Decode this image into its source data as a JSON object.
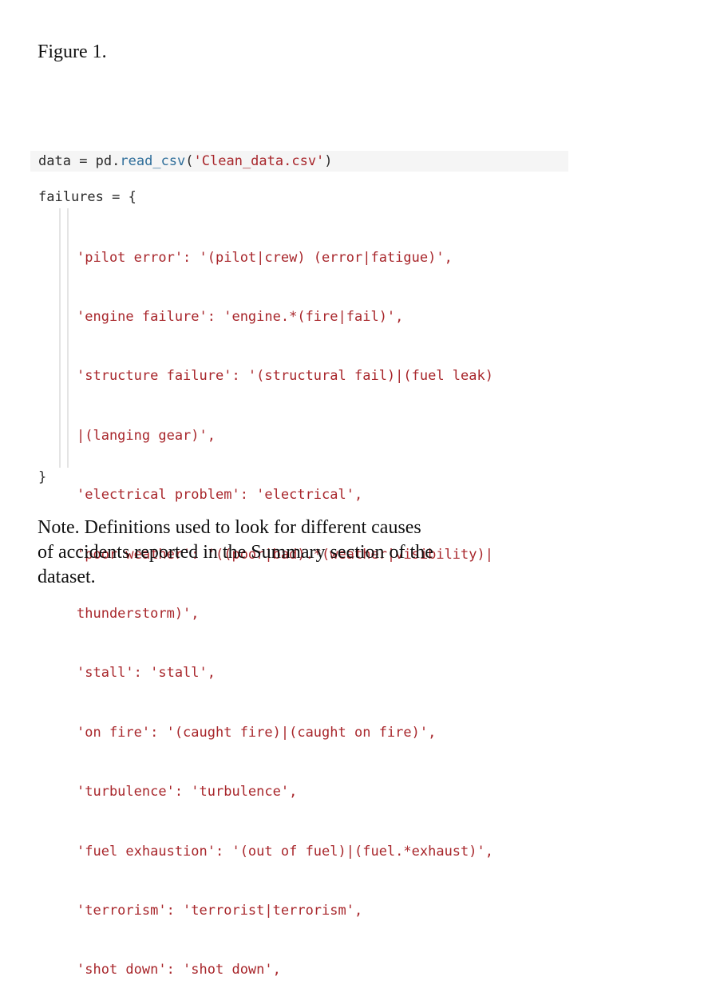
{
  "figure_label": "Figure 1.",
  "code": {
    "read_var": "data",
    "read_assign": " = ",
    "read_module": "pd.",
    "read_func": "read_csv",
    "read_open": "(",
    "read_arg": "'Clean_data.csv'",
    "read_close": ")",
    "failures_open": "failures = {",
    "entries": [
      "'pilot error': '(pilot|crew) (error|fatigue)',",
      "'engine failure': 'engine.*(fire|fail)',",
      "'structure failure': '(structural fail)|(fuel leak)",
      "|(langing gear)',",
      "'electrical problem': 'electrical',",
      "'poor weather': '((poor|bad).*(weather|visibility)|",
      "thunderstorm)',",
      "'stall': 'stall',",
      "'on fire': '(caught fire)|(caught on fire)',",
      "'turbulence': 'turbulence',",
      "'fuel exhaustion': '(out of fuel)|(fuel.*exhaust)',",
      "'terrorism': 'terrorist|terrorism',",
      "'shot down': 'shot down',"
    ],
    "failures_close": "}"
  },
  "note": "Note. Definitions used to look for different causes\nof accidents reported in the Summary section of the\ndataset."
}
